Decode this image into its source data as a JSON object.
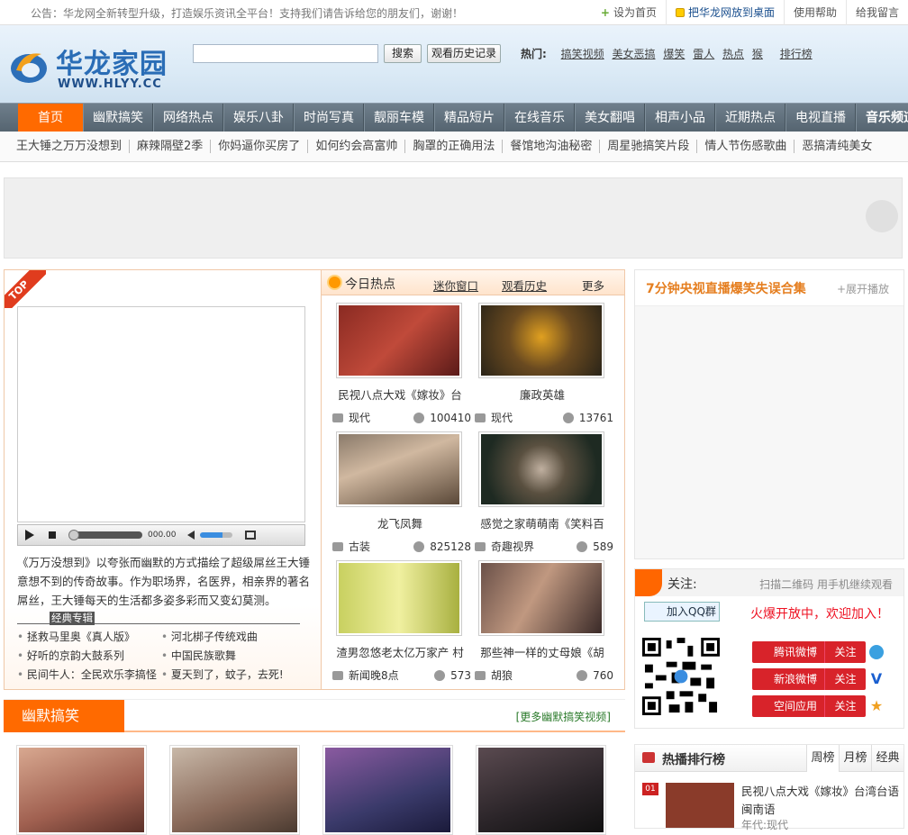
{
  "topbar": {
    "notice": "公告：华龙网全新转型升级，打造娱乐资讯全平台！支持我们请告诉给您的朋友们，谢谢！",
    "set_home": "设为首页",
    "add_desktop": "把华龙网放到桌面",
    "help": "使用帮助",
    "message": "给我留言"
  },
  "header": {
    "logo_cn": "华龙家园",
    "logo_en": "WWW.HLYY.CC",
    "search_placeholder": "",
    "search_button": "搜索",
    "history_button": "观看历史记录",
    "hot_label": "热门:",
    "hot_links": [
      "搞笑视频",
      "美女恶搞",
      "爆笑",
      "雷人",
      "热点",
      "猴",
      "排行榜"
    ]
  },
  "nav": {
    "items": [
      "首页",
      "幽默搞笑",
      "网络热点",
      "娱乐八卦",
      "时尚写真",
      "靓丽车模",
      "精品短片",
      "在线音乐",
      "美女翻唱",
      "相声小品",
      "近期热点",
      "电视直播",
      "音乐频道"
    ]
  },
  "subnav": {
    "items": [
      "王大锤之万万没想到",
      "麻辣隔壁2季",
      "你妈逼你买房了",
      "如何约会高富帅",
      "胸罩的正确用法",
      "餐馆地沟油秘密",
      "周星驰搞笑片段",
      "情人节伤感歌曲",
      "恶搞清纯美女"
    ]
  },
  "player": {
    "ribbon": "TOP",
    "time": "000.00",
    "description": "《万万没想到》以夸张而幽默的方式描绘了超级屌丝王大锤意想不到的传奇故事。作为职场界，名医界，相亲界的著名屌丝，王大锤每天的生活都多姿多彩而又变幻莫测。",
    "album_title": "经典专辑",
    "album": [
      "拯救马里奥《真人版》",
      "河北梆子传统戏曲",
      "好听的京韵大鼓系列",
      "中国民族歌舞",
      "民间牛人：全民欢乐李搞怪",
      "夏天到了，蚊子，去死!"
    ]
  },
  "today": {
    "title": "今日热点",
    "mini_window": "迷你窗口",
    "history": "观看历史",
    "more": "更多",
    "items": [
      {
        "title": "民视八点大戏《嫁妆》台",
        "category": "现代",
        "views": "100410",
        "color": "#7a2a22"
      },
      {
        "title": "廉政英雄",
        "category": "现代",
        "views": "13761",
        "color": "#5a4a2a"
      },
      {
        "title": "龙飞凤舞",
        "category": "古装",
        "views": "825128",
        "color": "#6a5a48"
      },
      {
        "title": "感觉之家萌萌南《笑料百",
        "category": "奇趣视界",
        "views": "589",
        "color": "#2e3a30"
      },
      {
        "title": "渣男忽悠老太亿万家产 村",
        "category": "新闻晚8点",
        "views": "573",
        "color": "#b8c050"
      },
      {
        "title": "那些神一样的丈母娘《胡",
        "category": "胡狼",
        "views": "760",
        "color": "#4a3a38"
      }
    ]
  },
  "right_top": {
    "title": "7分钟央视直播爆笑失误合集",
    "expand": "+展开播放"
  },
  "follow": {
    "title": "关注:",
    "scan": "扫描二维码 用手机继续观看",
    "qq_group": "加入QQ群",
    "welcome": "火爆开放中，欢迎加入！",
    "sns": [
      {
        "name": "腾讯微博",
        "follow": "关注"
      },
      {
        "name": "新浪微博",
        "follow": "关注"
      },
      {
        "name": "空间应用",
        "follow": "关注"
      }
    ]
  },
  "ranking": {
    "title": "热播排行榜",
    "tabs": [
      "周榜",
      "月榜",
      "经典"
    ],
    "first": {
      "rank": "01",
      "title": "民视八点大戏《嫁妆》台湾台语闽南语",
      "category": "年代:现代"
    }
  },
  "humor": {
    "title": "幽默搞笑",
    "more": "[更多幽默搞笑视频]",
    "thumb_colors": [
      "#c88a7a",
      "#a87a6a",
      "#6a4a7a",
      "#4a3a40"
    ]
  },
  "colors": {
    "accent": "#ff6a00",
    "nav_bg": "#5f6e7a",
    "brand": "#2a6db6"
  }
}
